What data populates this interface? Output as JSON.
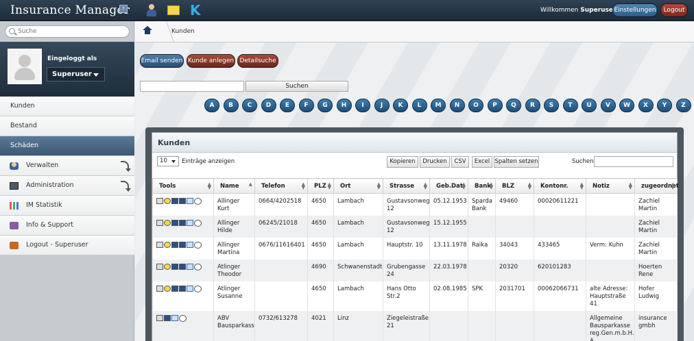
{
  "topbar": {
    "logo": "Insurance Manager",
    "logo_badge": "?",
    "welcome_prefix": "Willkommen",
    "welcome_user": "Superuser",
    "settings_label": "Einstellungen",
    "logout_label": "Logout"
  },
  "sidebar": {
    "search_placeholder": "Suche",
    "logged_in_label": "Eingeloggt als",
    "user": "Superuser",
    "items": [
      {
        "label": "Kunden"
      },
      {
        "label": "Bestand"
      },
      {
        "label": "Schäden"
      },
      {
        "label": "Verwalten"
      },
      {
        "label": "Administration"
      },
      {
        "label": "IM Statistik"
      },
      {
        "label": "Info & Support"
      },
      {
        "label": "Logout - Superuser"
      }
    ]
  },
  "breadcrumb": {
    "current": "Kunden"
  },
  "actions": {
    "email": "Email senden",
    "create": "Kunde anlegen",
    "detail": "Detailsuche",
    "search_button": "Suchen"
  },
  "alphabet": [
    "A",
    "B",
    "C",
    "D",
    "E",
    "F",
    "G",
    "H",
    "I",
    "J",
    "K",
    "L",
    "M",
    "N",
    "O",
    "P",
    "Q",
    "R",
    "S",
    "T",
    "U",
    "V",
    "W",
    "X",
    "Y",
    "Z"
  ],
  "panel": {
    "title": "Kunden",
    "length_value": "10",
    "length_label": "Einträge anzeigen",
    "buttons": {
      "copy": "Kopieren",
      "print": "Drucken",
      "csv": "CSV",
      "excel": "Excel",
      "columns": "Spalten setzen"
    },
    "search_label": "Suchen"
  },
  "table": {
    "headers": [
      "Tools",
      "Name",
      "Telefon",
      "PLZ",
      "Ort",
      "Strasse",
      "Geb.Dat",
      "Bank",
      "BLZ",
      "Kontonr.",
      "Notiz",
      "zugeordnet"
    ],
    "rows": [
      [
        "",
        "Allinger Kurt",
        "0664/4202518",
        "4650",
        "Lambach",
        "Gustavsonweg 12",
        "05.12.1953",
        "Sparda Bank",
        "49460",
        "00020611221",
        "",
        "Zachiel Martin"
      ],
      [
        "",
        "Allinger Hilde",
        "06245/21018",
        "4650",
        "Lambach",
        "Gustavsonweg 12",
        "15.12.1955",
        "",
        "",
        "",
        "",
        "Zachiel Martin"
      ],
      [
        "",
        "Allinger Martina",
        "0676/11616401",
        "4650",
        "Lambach",
        "Hauptstr. 10",
        "13.11.1978",
        "Raika",
        "34043",
        "433465",
        "Verm: Kuhn",
        "Zachiel Martin"
      ],
      [
        "",
        "Atlinger Theodor",
        "",
        "4690",
        "Schwanenstadt",
        "Grubengasse 24",
        "22.03.1978",
        "",
        "20320",
        "620101283",
        "",
        "Hoerten Rene"
      ],
      [
        "",
        "Atlinger Susanne",
        "",
        "4650",
        "Lambach",
        "Hans Otto Str.2",
        "02.08.1985",
        "SPK",
        "2031701",
        "00062066731",
        "alte Adresse: Hauptstraße 41",
        "Hofer Ludwig"
      ],
      [
        "",
        "ABV Bausparkasse",
        "0732/613278",
        "4021",
        "Linz",
        "Ziegeleistraße 21",
        "",
        "",
        "",
        "",
        "Allgemeine Bausparkasse reg.Gen.m.b.H. A",
        "insurance gmbh"
      ]
    ]
  }
}
